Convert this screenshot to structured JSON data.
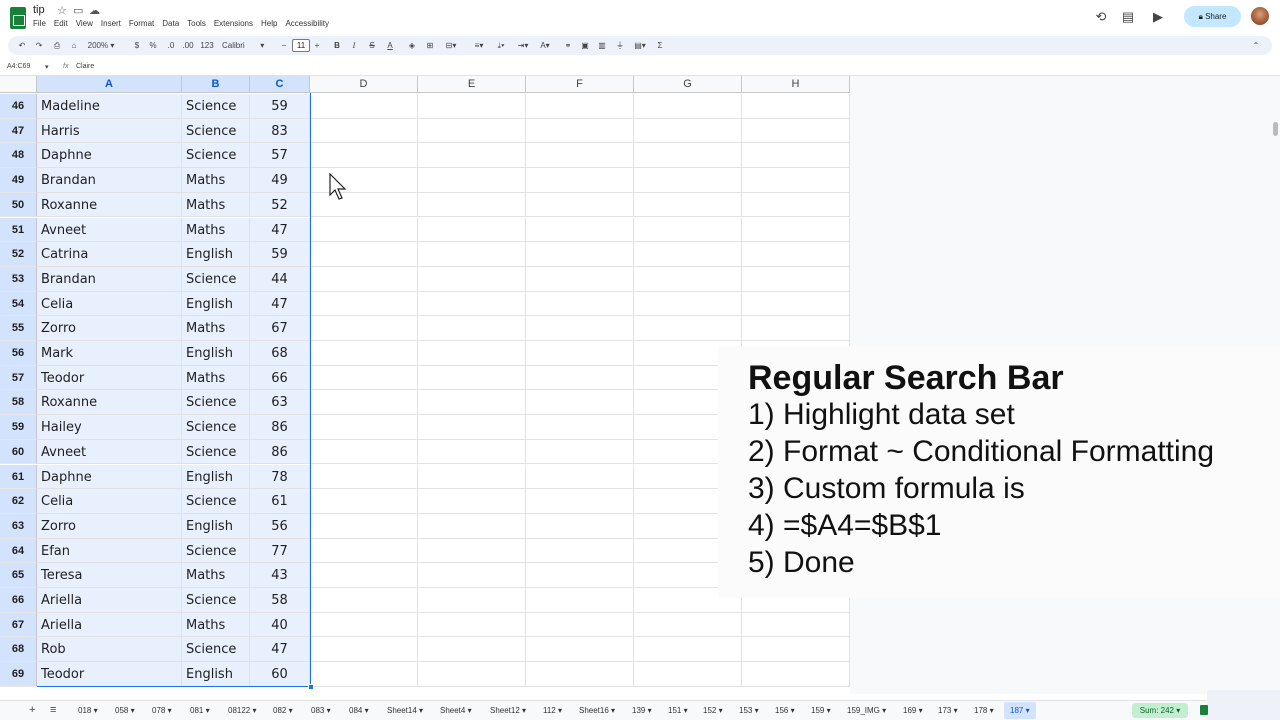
{
  "app": {
    "doc_title": "tip",
    "menu": [
      "File",
      "Edit",
      "View",
      "Insert",
      "Format",
      "Data",
      "Tools",
      "Extensions",
      "Help",
      "Accessibility"
    ],
    "share_label": "Share"
  },
  "toolbar": {
    "zoom": "200%",
    "font": "Calibri",
    "font_size": "11",
    "currency": "$",
    "percent": "%",
    "format_123": "123",
    "sum_symbol": "Σ"
  },
  "formula_bar": {
    "name_box": "A4:C69",
    "formula": "Claire"
  },
  "columns": [
    "A",
    "B",
    "C",
    "D",
    "E",
    "F",
    "G",
    "H"
  ],
  "rows": [
    {
      "n": "46",
      "name": "Madeline",
      "subject": "Science",
      "score": "59"
    },
    {
      "n": "47",
      "name": "Harris",
      "subject": "Science",
      "score": "83"
    },
    {
      "n": "48",
      "name": "Daphne",
      "subject": "Science",
      "score": "57"
    },
    {
      "n": "49",
      "name": "Brandan",
      "subject": "Maths",
      "score": "49"
    },
    {
      "n": "50",
      "name": "Roxanne",
      "subject": "Maths",
      "score": "52"
    },
    {
      "n": "51",
      "name": "Avneet",
      "subject": "Maths",
      "score": "47"
    },
    {
      "n": "52",
      "name": "Catrina",
      "subject": "English",
      "score": "59"
    },
    {
      "n": "53",
      "name": "Brandan",
      "subject": "Science",
      "score": "44"
    },
    {
      "n": "54",
      "name": "Celia",
      "subject": "English",
      "score": "47"
    },
    {
      "n": "55",
      "name": "Zorro",
      "subject": "Maths",
      "score": "67"
    },
    {
      "n": "56",
      "name": "Mark",
      "subject": "English",
      "score": "68"
    },
    {
      "n": "57",
      "name": "Teodor",
      "subject": "Maths",
      "score": "66"
    },
    {
      "n": "58",
      "name": "Roxanne",
      "subject": "Science",
      "score": "63"
    },
    {
      "n": "59",
      "name": "Hailey",
      "subject": "Science",
      "score": "86"
    },
    {
      "n": "60",
      "name": "Avneet",
      "subject": "Science",
      "score": "86"
    },
    {
      "n": "61",
      "name": "Daphne",
      "subject": "English",
      "score": "78"
    },
    {
      "n": "62",
      "name": "Celia",
      "subject": "Science",
      "score": "61"
    },
    {
      "n": "63",
      "name": "Zorro",
      "subject": "English",
      "score": "56"
    },
    {
      "n": "64",
      "name": "Efan",
      "subject": "Science",
      "score": "77"
    },
    {
      "n": "65",
      "name": "Teresa",
      "subject": "Maths",
      "score": "43"
    },
    {
      "n": "66",
      "name": "Ariella",
      "subject": "Science",
      "score": "58"
    },
    {
      "n": "67",
      "name": "Ariella",
      "subject": "Maths",
      "score": "40"
    },
    {
      "n": "68",
      "name": "Rob",
      "subject": "Science",
      "score": "47"
    },
    {
      "n": "69",
      "name": "Teodor",
      "subject": "English",
      "score": "60"
    }
  ],
  "overlay": {
    "title": "Regular Search Bar",
    "steps": [
      "1) Highlight data set",
      "2) Format ~ Conditional Formatting",
      "3) Custom formula is",
      "4) =$A4=$B$1",
      "5) Done"
    ]
  },
  "sheet_tabs": [
    "018",
    "058",
    "078",
    "081",
    "08122",
    "082",
    "083",
    "084",
    "Sheet14",
    "Sheet4",
    "Sheet12",
    "112",
    "Sheet16",
    "139",
    "151",
    "152",
    "153",
    "156",
    "159",
    "159_IMG",
    "169",
    "173",
    "178",
    "187"
  ],
  "active_tab": "187",
  "sum_label": "Sum: 242",
  "colors": {
    "selection": "#e8f0fe",
    "accent": "#1a73e8",
    "share": "#c2e7ff",
    "brand": "#188038"
  }
}
